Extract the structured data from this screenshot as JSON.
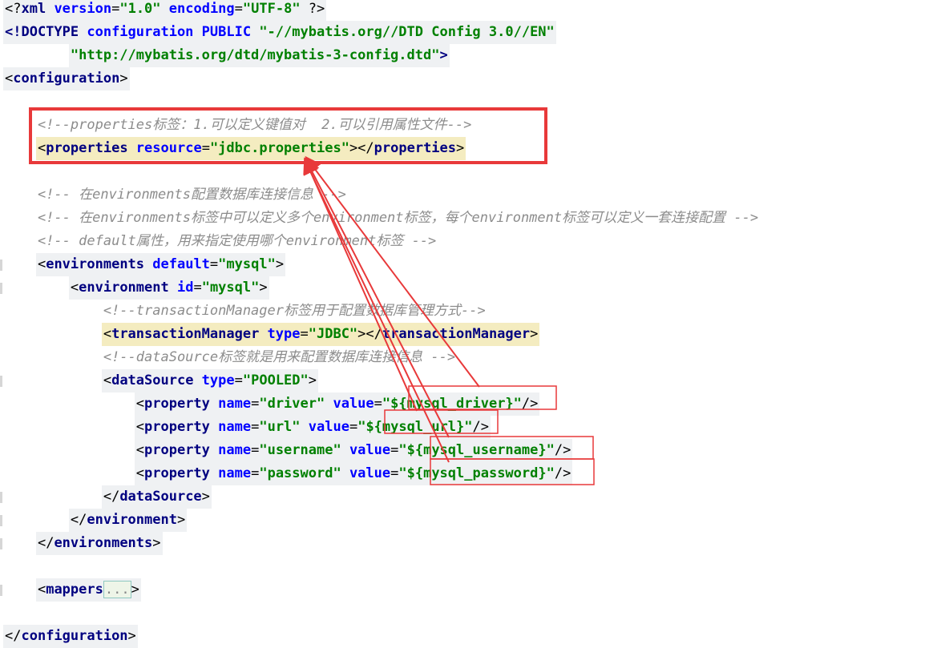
{
  "lines": [
    {
      "name": "xml-declaration-line",
      "segments": [
        {
          "t": "<?",
          "c": "pun"
        },
        {
          "t": "xml",
          "c": "tag"
        },
        {
          "t": " version",
          "c": "attr"
        },
        {
          "t": "=",
          "c": "pun"
        },
        {
          "t": "\"1.0\"",
          "c": "str"
        },
        {
          "t": " encoding",
          "c": "attr"
        },
        {
          "t": "=",
          "c": "pun"
        },
        {
          "t": "\"UTF-8\"",
          "c": "str"
        },
        {
          "t": " ?>",
          "c": "pun"
        }
      ]
    },
    {
      "name": "doctype-line",
      "segments": [
        {
          "t": "<!DOCTYPE",
          "c": "tag"
        },
        {
          "t": " configuration",
          "c": "attr"
        },
        {
          "t": " PUBLIC",
          "c": "attr"
        },
        {
          "t": " \"-//mybatis.org//DTD Config 3.0//EN\"",
          "c": "str"
        }
      ]
    },
    {
      "name": "doctype-dtd-line",
      "segments": [
        {
          "t": "        \"http://mybatis.org/dtd/mybatis-3-config.dtd\"",
          "c": "str"
        },
        {
          "t": ">",
          "c": "tag"
        }
      ]
    },
    {
      "name": "configuration-open-line",
      "segments": [
        {
          "t": "<",
          "c": "pun"
        },
        {
          "t": "configuration",
          "c": "tag"
        },
        {
          "t": ">",
          "c": "pun"
        }
      ]
    },
    {
      "name": "blank-line",
      "segments": []
    },
    {
      "name": "properties-comment-line",
      "segments": [
        {
          "t": "    <!--properties标签：1.可以定义键值对  2.可以引用属性文件-->",
          "c": "cmt"
        }
      ]
    },
    {
      "name": "properties-tag-line",
      "current": true,
      "segments": [
        {
          "t": "    <",
          "c": "pun"
        },
        {
          "t": "properties",
          "c": "tag"
        },
        {
          "t": " resource",
          "c": "attr"
        },
        {
          "t": "=",
          "c": "pun"
        },
        {
          "t": "\"jdbc.properties\"",
          "c": "str"
        },
        {
          "t": "></",
          "c": "pun"
        },
        {
          "t": "properties",
          "c": "tag"
        },
        {
          "t": ">",
          "c": "pun"
        }
      ]
    },
    {
      "name": "blank-line",
      "segments": []
    },
    {
      "name": "environments-comment-line",
      "segments": [
        {
          "t": "    <!-- 在environments配置数据库连接信息 -->",
          "c": "cmt"
        }
      ]
    },
    {
      "name": "environments-comment-line-2",
      "segments": [
        {
          "t": "    <!-- 在environments标签中可以定义多个environment标签，每个environment标签可以定义一套连接配置 -->",
          "c": "cmt"
        }
      ]
    },
    {
      "name": "default-comment-line",
      "segments": [
        {
          "t": "    <!-- default属性，用来指定使用哪个environment标签 -->",
          "c": "cmt"
        }
      ]
    },
    {
      "name": "environments-open-line",
      "fold": true,
      "segments": [
        {
          "t": "    <",
          "c": "pun"
        },
        {
          "t": "environments",
          "c": "tag"
        },
        {
          "t": " default",
          "c": "attr"
        },
        {
          "t": "=",
          "c": "pun"
        },
        {
          "t": "\"mysql\"",
          "c": "str"
        },
        {
          "t": ">",
          "c": "pun"
        }
      ]
    },
    {
      "name": "environment-open-line",
      "fold": true,
      "segments": [
        {
          "t": "        <",
          "c": "pun"
        },
        {
          "t": "environment",
          "c": "tag"
        },
        {
          "t": " id",
          "c": "attr"
        },
        {
          "t": "=",
          "c": "pun"
        },
        {
          "t": "\"mysql\"",
          "c": "str"
        },
        {
          "t": ">",
          "c": "pun"
        }
      ]
    },
    {
      "name": "transaction-comment-line",
      "segments": [
        {
          "t": "            <!--transactionManager标签用于配置数据库管理方式-->",
          "c": "cmt"
        }
      ]
    },
    {
      "name": "transaction-manager-line",
      "current": true,
      "segments": [
        {
          "t": "            <",
          "c": "pun"
        },
        {
          "t": "transactionManager",
          "c": "tag"
        },
        {
          "t": " type",
          "c": "attr"
        },
        {
          "t": "=",
          "c": "pun"
        },
        {
          "t": "\"JDBC\"",
          "c": "str"
        },
        {
          "t": "></",
          "c": "pun"
        },
        {
          "t": "transactionManager",
          "c": "tag"
        },
        {
          "t": ">",
          "c": "pun"
        }
      ]
    },
    {
      "name": "datasource-comment-line",
      "segments": [
        {
          "t": "            <!--dataSource标签就是用来配置数据库连接信息 -->",
          "c": "cmt"
        }
      ]
    },
    {
      "name": "datasource-open-line",
      "fold": true,
      "segments": [
        {
          "t": "            <",
          "c": "pun"
        },
        {
          "t": "dataSource",
          "c": "tag"
        },
        {
          "t": " type",
          "c": "attr"
        },
        {
          "t": "=",
          "c": "pun"
        },
        {
          "t": "\"POOLED\"",
          "c": "str"
        },
        {
          "t": ">",
          "c": "pun"
        }
      ]
    },
    {
      "name": "property-driver-line",
      "segments": [
        {
          "t": "                <",
          "c": "pun"
        },
        {
          "t": "property",
          "c": "tag"
        },
        {
          "t": " name",
          "c": "attr"
        },
        {
          "t": "=",
          "c": "pun"
        },
        {
          "t": "\"driver\"",
          "c": "str"
        },
        {
          "t": " value",
          "c": "attr"
        },
        {
          "t": "=",
          "c": "pun"
        },
        {
          "t": "\"${mysql_driver}\"",
          "c": "str"
        },
        {
          "t": "/>",
          "c": "pun"
        }
      ]
    },
    {
      "name": "property-url-line",
      "segments": [
        {
          "t": "                <",
          "c": "pun"
        },
        {
          "t": "property",
          "c": "tag"
        },
        {
          "t": " name",
          "c": "attr"
        },
        {
          "t": "=",
          "c": "pun"
        },
        {
          "t": "\"url\"",
          "c": "str"
        },
        {
          "t": " value",
          "c": "attr"
        },
        {
          "t": "=",
          "c": "pun"
        },
        {
          "t": "\"${mysql_url}\"",
          "c": "str"
        },
        {
          "t": "/>",
          "c": "pun"
        }
      ]
    },
    {
      "name": "property-username-line",
      "segments": [
        {
          "t": "                <",
          "c": "pun"
        },
        {
          "t": "property",
          "c": "tag"
        },
        {
          "t": " name",
          "c": "attr"
        },
        {
          "t": "=",
          "c": "pun"
        },
        {
          "t": "\"username\"",
          "c": "str"
        },
        {
          "t": " value",
          "c": "attr"
        },
        {
          "t": "=",
          "c": "pun"
        },
        {
          "t": "\"${mysql_username}\"",
          "c": "str"
        },
        {
          "t": "/>",
          "c": "pun"
        }
      ]
    },
    {
      "name": "property-password-line",
      "segments": [
        {
          "t": "                <",
          "c": "pun"
        },
        {
          "t": "property",
          "c": "tag"
        },
        {
          "t": " name",
          "c": "attr"
        },
        {
          "t": "=",
          "c": "pun"
        },
        {
          "t": "\"password\"",
          "c": "str"
        },
        {
          "t": " value",
          "c": "attr"
        },
        {
          "t": "=",
          "c": "pun"
        },
        {
          "t": "\"${mysql_password}\"",
          "c": "str"
        },
        {
          "t": "/>",
          "c": "pun"
        }
      ]
    },
    {
      "name": "datasource-close-line",
      "fold": true,
      "segments": [
        {
          "t": "            </",
          "c": "pun"
        },
        {
          "t": "dataSource",
          "c": "tag"
        },
        {
          "t": ">",
          "c": "pun"
        }
      ]
    },
    {
      "name": "environment-close-line",
      "fold": true,
      "segments": [
        {
          "t": "        </",
          "c": "pun"
        },
        {
          "t": "environment",
          "c": "tag"
        },
        {
          "t": ">",
          "c": "pun"
        }
      ]
    },
    {
      "name": "environments-close-line",
      "fold": true,
      "segments": [
        {
          "t": "    </",
          "c": "pun"
        },
        {
          "t": "environments",
          "c": "tag"
        },
        {
          "t": ">",
          "c": "pun"
        }
      ]
    },
    {
      "name": "blank-line",
      "segments": []
    },
    {
      "name": "mappers-line",
      "fold": true,
      "segments": [
        {
          "t": "    <",
          "c": "pun"
        },
        {
          "t": "mappers",
          "c": "tag"
        },
        {
          "t": "...",
          "c": "collapsed"
        },
        {
          "t": ">",
          "c": "pun"
        }
      ]
    },
    {
      "name": "blank-line",
      "segments": []
    },
    {
      "name": "configuration-close-line",
      "segments": [
        {
          "t": "</",
          "c": "pun"
        },
        {
          "t": "configuration",
          "c": "tag"
        },
        {
          "t": ">",
          "c": "pun"
        }
      ]
    }
  ],
  "annotations": {
    "highlight_color": "#e8393a",
    "boxes": [
      "properties-block-box",
      "driver-value-box",
      "url-value-box",
      "username-value-box",
      "password-value-box"
    ]
  }
}
